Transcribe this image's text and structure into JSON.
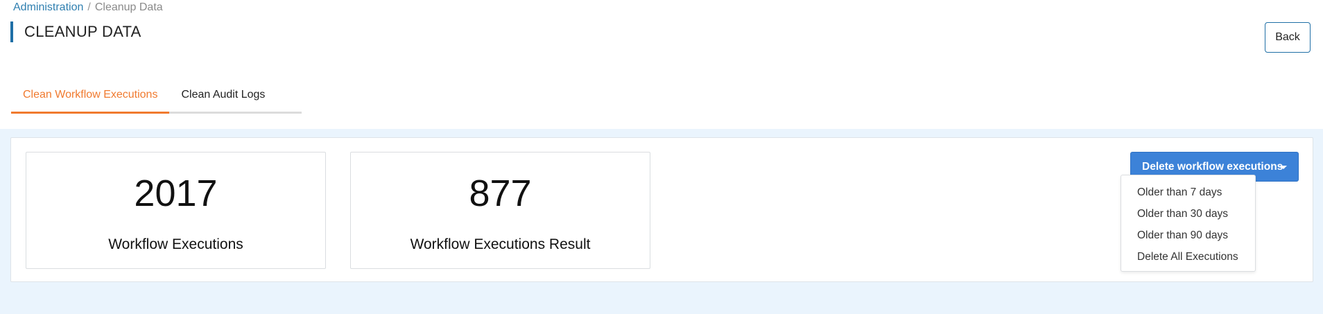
{
  "breadcrumb": {
    "parent": "Administration",
    "separator": "/",
    "current": "Cleanup Data"
  },
  "page": {
    "title": "CLEANUP DATA",
    "back_label": "Back"
  },
  "tabs": [
    {
      "label": "Clean Workflow Executions",
      "active": true
    },
    {
      "label": "Clean Audit Logs",
      "active": false
    }
  ],
  "stats": [
    {
      "value": "2017",
      "label": "Workflow Executions"
    },
    {
      "value": "877",
      "label": "Workflow Executions Result"
    }
  ],
  "delete_dropdown": {
    "label": "Delete workflow executions",
    "icon": "caret-down-icon",
    "options": [
      "Older than 7 days",
      "Older than 30 days",
      "Older than 90 days",
      "Delete All Executions"
    ]
  },
  "colors": {
    "accent_blue": "#1f6fa6",
    "active_tab": "#f07a2f",
    "primary_button": "#3c82d8",
    "content_background": "#eaf4fd"
  }
}
